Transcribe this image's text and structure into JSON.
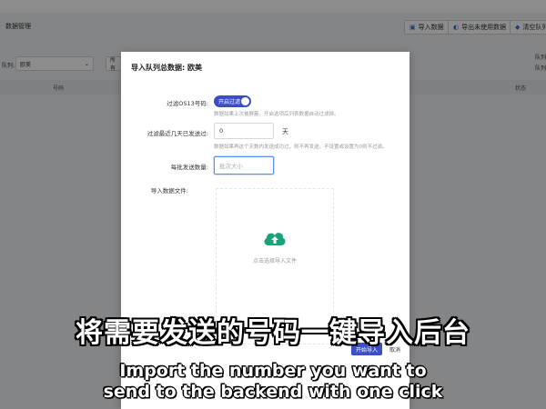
{
  "background": {
    "page_title": "数据管理",
    "buttons": [
      {
        "icon": "import-icon",
        "label": "导入数据"
      },
      {
        "icon": "export-icon",
        "label": "导出未使用数据"
      },
      {
        "icon": "clear-icon",
        "label": "清空队列"
      }
    ],
    "filter_label": "队列:",
    "filter_value": "欧美",
    "filter2_value": "所有",
    "col_number": "号码",
    "col_status": "状态",
    "right_text_1": "队列",
    "right_text_2": "队列"
  },
  "modal": {
    "title": "导入队列总数据: 欧美",
    "filter_os13": {
      "label": "过滤OS13号码:",
      "toggle_text": "开启过滤",
      "hint": "数据如果上次被屏蔽，开启选项后列表数据自动过滤掉。"
    },
    "days_filter": {
      "label": "过滤最近几天已发送过:",
      "value": "0",
      "unit": "天",
      "hint": "数据如果再这个天数内发送成功过，则不再发送。不设置或设置为0则不过滤。"
    },
    "batch": {
      "label": "每批发送数量:",
      "placeholder": "批次大小"
    },
    "upload": {
      "label": "导入数据文件:",
      "text": "点击选择导入文件"
    },
    "confirm_label": "开始导入",
    "cancel_label": "取消"
  },
  "subtitles": {
    "chinese": "将需要发送的号码一键导入后台",
    "english_line1": "Import the number you want to",
    "english_line2": "send to the backend with one click"
  },
  "colors": {
    "primary": "#3b4ec6",
    "upload_icon": "#1aa37a"
  }
}
